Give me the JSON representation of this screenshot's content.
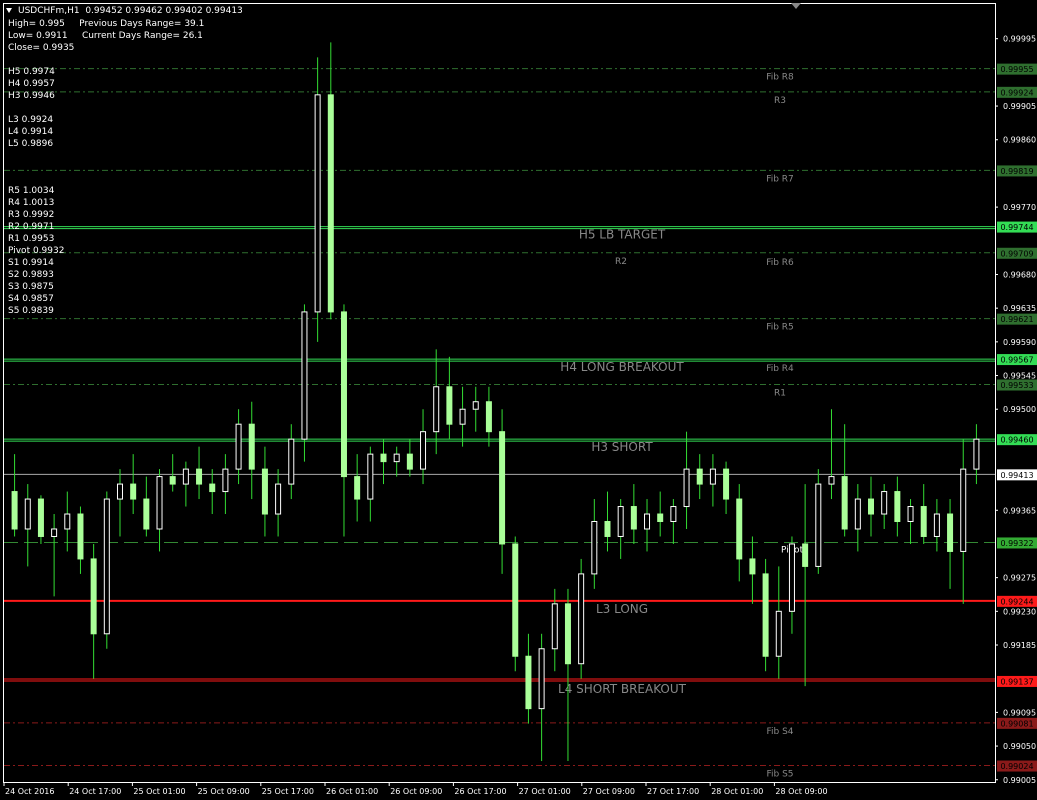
{
  "header": {
    "symbol": "USDCHFm,H1",
    "ohlc": "0.99452 0.99462 0.99402 0.99413",
    "high_label": "High= 0.995",
    "prev_range": "Previous Days Range= 39.1",
    "low_label": "Low= 0.9911",
    "curr_range": "Current Days Range= 26.1",
    "close_label": "Close= 0.9935"
  },
  "camarilla": [
    "H5 0.9974",
    "H4 0.9957",
    "H3 0.9946",
    "",
    "L3 0.9924",
    "L4 0.9914",
    "L5 0.9896"
  ],
  "pivots": [
    "R5 1.0034",
    "R4 1.0013",
    "R3 0.9992",
    "R2 0.9971",
    "R1 0.9953",
    "Pivot 0.9932",
    "S1 0.9914",
    "S2 0.9893",
    "S3 0.9875",
    "S4 0.9857",
    "S5 0.9839"
  ],
  "colors": {
    "bull": "#ffffff",
    "bear": "#aaff99",
    "wick": "#33dd33",
    "fib_line": "#2f6f2f",
    "green_line": "#33dd55",
    "red_line": "#ff1a1a",
    "dark_red_line": "#8a1a1a",
    "axis": "#ffffff",
    "label_text": "#888888"
  },
  "chart_data": {
    "type": "candlestick",
    "price_range": [
      0.99002,
      1.0004
    ],
    "price_axis_ticks": [
      "0.99995",
      "0.99905",
      "0.99860",
      "0.99770",
      "0.99680",
      "0.99635",
      "0.99590",
      "0.99545",
      "0.99500",
      "0.99365",
      "0.99275",
      "0.99230",
      "0.99185",
      "0.99095",
      "0.99050",
      "0.99005"
    ],
    "time_axis_labels": [
      "24 Oct 2016",
      "24 Oct 17:00",
      "25 Oct 01:00",
      "25 Oct 09:00",
      "25 Oct 17:00",
      "26 Oct 01:00",
      "26 Oct 09:00",
      "26 Oct 17:00",
      "27 Oct 01:00",
      "27 Oct 09:00",
      "27 Oct 17:00",
      "28 Oct 01:00",
      "28 Oct 09:00"
    ],
    "levels": [
      {
        "price": 0.99955,
        "tag": "0.99955",
        "label": "Fib R8",
        "style": "fib"
      },
      {
        "price": 0.99924,
        "tag": "0.99924",
        "label": "R3",
        "style": "fib"
      },
      {
        "price": 0.99819,
        "tag": "0.99819",
        "label": "Fib R7",
        "style": "fib"
      },
      {
        "price": 0.99744,
        "tag": "0.99744",
        "label": "H5 LB TARGET",
        "style": "green"
      },
      {
        "price": 0.99709,
        "tag": "0.99709",
        "label": "R2",
        "style": "fib2"
      },
      {
        "price": 0.99621,
        "tag": "0.99621",
        "label": "Fib R5",
        "style": "fib"
      },
      {
        "price": 0.99567,
        "tag": "0.99567",
        "label": "H4 LONG BREAKOUT",
        "style": "green"
      },
      {
        "price": 0.99533,
        "tag": "0.99533",
        "label": "R1",
        "style": "fib"
      },
      {
        "price": 0.9946,
        "tag": "0.99460",
        "label": "H3 SHORT",
        "style": "green"
      },
      {
        "price": 0.99413,
        "tag": "0.99413",
        "label": "",
        "style": "current"
      },
      {
        "price": 0.99322,
        "tag": "0.99322",
        "label": "Pivot",
        "style": "pivot"
      },
      {
        "price": 0.99244,
        "tag": "0.99244",
        "label": "L3 LONG",
        "style": "red"
      },
      {
        "price": 0.99137,
        "tag": "0.99137",
        "label": "L4 SHORT BREAKOUT",
        "style": "red2"
      },
      {
        "price": 0.99081,
        "tag": "0.99081",
        "label": "Fib S4",
        "style": "darkred"
      },
      {
        "price": 0.99024,
        "tag": "0.99024",
        "label": "Fib S5",
        "style": "darkred"
      }
    ],
    "extra_level_labels": [
      {
        "price": 0.99709,
        "label": "Fib R6"
      },
      {
        "price": 0.99567,
        "label": "Fib R4"
      }
    ],
    "candles": [
      [
        0.9939,
        0.9944,
        0.9933,
        0.9934
      ],
      [
        0.9934,
        0.994,
        0.9929,
        0.9938
      ],
      [
        0.9938,
        0.99385,
        0.9932,
        0.9933
      ],
      [
        0.9933,
        0.9936,
        0.9925,
        0.9934
      ],
      [
        0.9934,
        0.9939,
        0.9931,
        0.9936
      ],
      [
        0.9936,
        0.9937,
        0.9928,
        0.993
      ],
      [
        0.993,
        0.9932,
        0.9914,
        0.992
      ],
      [
        0.992,
        0.9939,
        0.9918,
        0.9938
      ],
      [
        0.9938,
        0.9942,
        0.9933,
        0.994
      ],
      [
        0.994,
        0.9944,
        0.9936,
        0.9938
      ],
      [
        0.9938,
        0.9941,
        0.9933,
        0.9934
      ],
      [
        0.9934,
        0.9942,
        0.9931,
        0.9941
      ],
      [
        0.9941,
        0.9944,
        0.9939,
        0.994
      ],
      [
        0.994,
        0.9943,
        0.9937,
        0.9942
      ],
      [
        0.9942,
        0.9945,
        0.9938,
        0.994
      ],
      [
        0.994,
        0.9942,
        0.9936,
        0.9939
      ],
      [
        0.9939,
        0.9944,
        0.9936,
        0.9942
      ],
      [
        0.9942,
        0.995,
        0.994,
        0.9948
      ],
      [
        0.9948,
        0.9951,
        0.9938,
        0.9942
      ],
      [
        0.9942,
        0.9945,
        0.9933,
        0.9936
      ],
      [
        0.9936,
        0.9942,
        0.9933,
        0.994
      ],
      [
        0.994,
        0.9948,
        0.9938,
        0.9946
      ],
      [
        0.9946,
        0.9964,
        0.9943,
        0.9963
      ],
      [
        0.9963,
        0.9997,
        0.9959,
        0.9992
      ],
      [
        0.9992,
        0.9999,
        0.9962,
        0.9963
      ],
      [
        0.9963,
        0.9964,
        0.9933,
        0.9941
      ],
      [
        0.9941,
        0.9944,
        0.9935,
        0.9938
      ],
      [
        0.9938,
        0.9945,
        0.9935,
        0.9944
      ],
      [
        0.9944,
        0.9946,
        0.994,
        0.9943
      ],
      [
        0.9943,
        0.9945,
        0.9941,
        0.9944
      ],
      [
        0.9944,
        0.9946,
        0.9941,
        0.9942
      ],
      [
        0.9942,
        0.995,
        0.994,
        0.9947
      ],
      [
        0.9947,
        0.9958,
        0.9944,
        0.9953
      ],
      [
        0.9953,
        0.9957,
        0.9946,
        0.9948
      ],
      [
        0.9948,
        0.9953,
        0.9945,
        0.995
      ],
      [
        0.995,
        0.9953,
        0.9947,
        0.9951
      ],
      [
        0.9951,
        0.9953,
        0.9945,
        0.9947
      ],
      [
        0.9947,
        0.995,
        0.9928,
        0.9932
      ],
      [
        0.9932,
        0.9933,
        0.9915,
        0.9917
      ],
      [
        0.9917,
        0.992,
        0.9908,
        0.991
      ],
      [
        0.991,
        0.992,
        0.9903,
        0.9918
      ],
      [
        0.9918,
        0.9926,
        0.9915,
        0.9924
      ],
      [
        0.9924,
        0.9926,
        0.9903,
        0.9916
      ],
      [
        0.9916,
        0.993,
        0.9914,
        0.9928
      ],
      [
        0.9928,
        0.9938,
        0.9926,
        0.9935
      ],
      [
        0.9935,
        0.9939,
        0.9931,
        0.9933
      ],
      [
        0.9933,
        0.9938,
        0.993,
        0.9937
      ],
      [
        0.9937,
        0.994,
        0.9932,
        0.9934
      ],
      [
        0.9934,
        0.9938,
        0.9931,
        0.9936
      ],
      [
        0.9936,
        0.9939,
        0.9933,
        0.9935
      ],
      [
        0.9935,
        0.9938,
        0.9932,
        0.9937
      ],
      [
        0.9937,
        0.9947,
        0.9934,
        0.9942
      ],
      [
        0.9942,
        0.9944,
        0.9938,
        0.994
      ],
      [
        0.994,
        0.9944,
        0.9937,
        0.9942
      ],
      [
        0.9942,
        0.9943,
        0.9936,
        0.9938
      ],
      [
        0.9938,
        0.994,
        0.9927,
        0.993
      ],
      [
        0.993,
        0.9933,
        0.9924,
        0.9928
      ],
      [
        0.9928,
        0.993,
        0.9915,
        0.9917
      ],
      [
        0.9917,
        0.9929,
        0.9914,
        0.9923
      ],
      [
        0.9923,
        0.9933,
        0.992,
        0.9932
      ],
      [
        0.9932,
        0.994,
        0.9913,
        0.9929
      ],
      [
        0.9929,
        0.9942,
        0.9928,
        0.994
      ],
      [
        0.994,
        0.995,
        0.9938,
        0.9941
      ],
      [
        0.9941,
        0.9948,
        0.9933,
        0.9934
      ],
      [
        0.9934,
        0.994,
        0.9931,
        0.9938
      ],
      [
        0.9938,
        0.9941,
        0.9933,
        0.9936
      ],
      [
        0.9936,
        0.994,
        0.9934,
        0.9939
      ],
      [
        0.9939,
        0.9941,
        0.9933,
        0.9935
      ],
      [
        0.9935,
        0.9938,
        0.9932,
        0.9937
      ],
      [
        0.9937,
        0.994,
        0.9932,
        0.9933
      ],
      [
        0.9933,
        0.9938,
        0.9931,
        0.9936
      ],
      [
        0.9936,
        0.9938,
        0.9926,
        0.9931
      ],
      [
        0.9931,
        0.9946,
        0.9924,
        0.9942
      ],
      [
        0.9942,
        0.9948,
        0.994,
        0.9946
      ]
    ]
  }
}
